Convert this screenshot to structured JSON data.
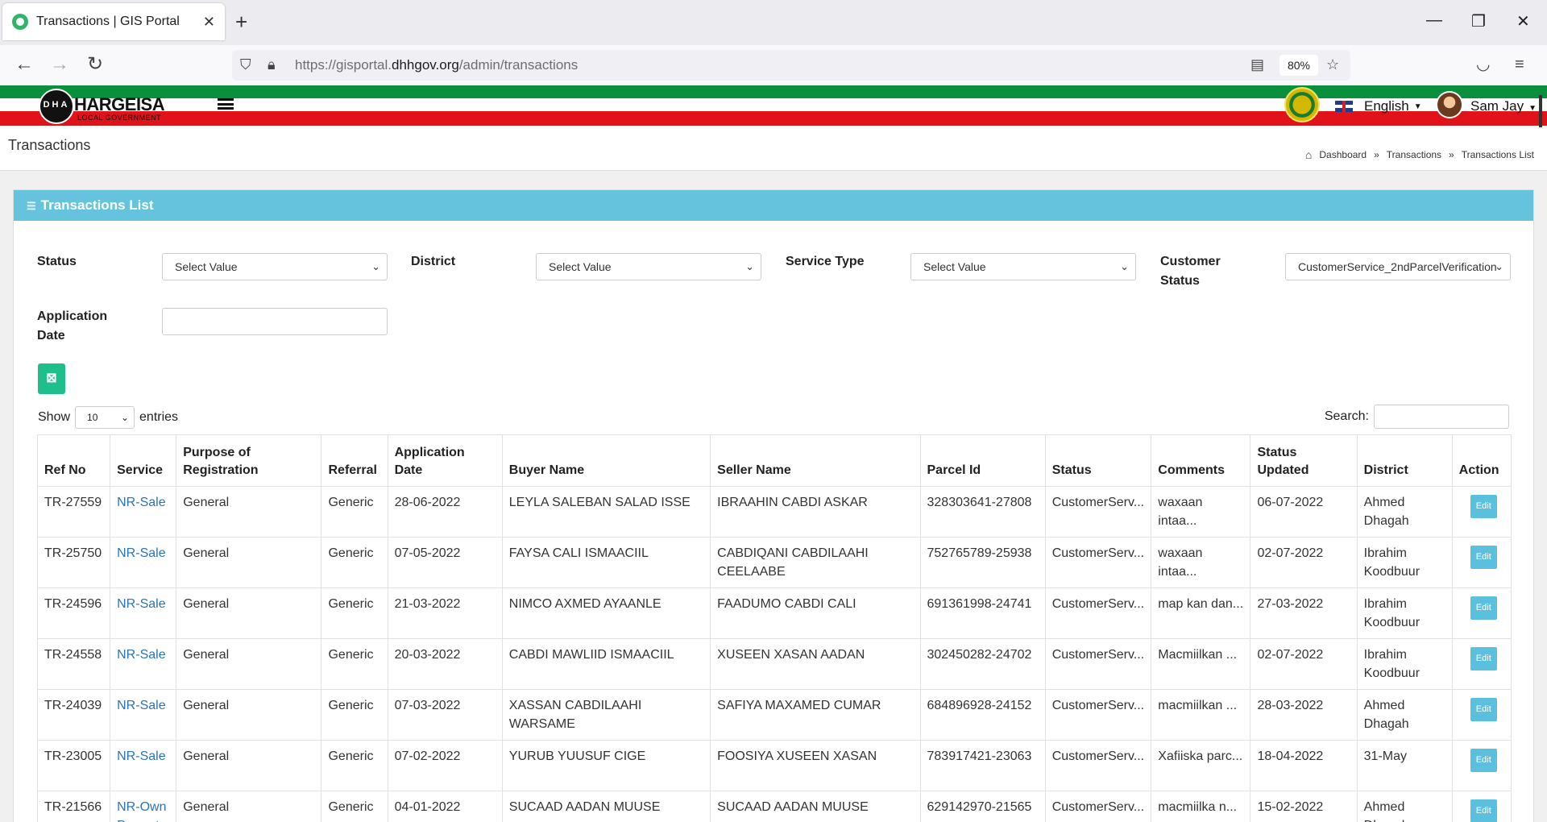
{
  "browser": {
    "tab_title": "Transactions | GIS Portal",
    "url_prefix": "https://gisportal.",
    "url_domain": "dhhgov.org",
    "url_path": "/admin/transactions",
    "zoom": "80%"
  },
  "header": {
    "logo_title": "HARGEISA",
    "logo_subtitle": "LOCAL GOVERNMENT",
    "logo_initials": "DHA",
    "language": "English",
    "user_name": "Sam Jay"
  },
  "page": {
    "title": "Transactions",
    "breadcrumb": [
      "Dashboard",
      "Transactions",
      "Transactions List"
    ],
    "breadcrumb_sep": "»"
  },
  "card": {
    "title": "Transactions List"
  },
  "filters": {
    "status_label": "Status",
    "status_value": "Select Value",
    "district_label": "District",
    "district_value": "Select Value",
    "service_type_label": "Service Type",
    "service_type_value": "Select Value",
    "customer_status_label_1": "Customer",
    "customer_status_label_2": "Status",
    "customer_status_value": "CustomerService_2ndParcelVerification",
    "application_date_label_1": "Application",
    "application_date_label_2": "Date"
  },
  "table_controls": {
    "show": "Show",
    "page_length": "10",
    "entries": "entries",
    "search": "Search:"
  },
  "table": {
    "columns": [
      "Ref No",
      "Service",
      "Purpose of Registration",
      "Referral",
      "Application Date",
      "Buyer Name",
      "Seller Name",
      "Parcel Id",
      "Status",
      "Comments",
      "Status Updated",
      "District",
      "Action"
    ],
    "edit_label": "Edit",
    "rows": [
      {
        "ref": "TR-27559",
        "service": "NR-Sale",
        "purpose": "General",
        "referral": "Generic",
        "app_date": "28-06-2022",
        "buyer": "LEYLA SALEBAN SALAD ISSE",
        "seller": "IBRAAHIN CABDI ASKAR",
        "parcel": "328303641-27808",
        "status": "CustomerServ...",
        "comments": "waxaan intaa...",
        "updated": "06-07-2022",
        "district": "Ahmed Dhagah"
      },
      {
        "ref": "TR-25750",
        "service": "NR-Sale",
        "purpose": "General",
        "referral": "Generic",
        "app_date": "07-05-2022",
        "buyer": "FAYSA CALI ISMAACIIL",
        "seller": "CABDIQANI CABDILAAHI CEELAABE",
        "parcel": "752765789-25938",
        "status": "CustomerServ...",
        "comments": "waxaan intaa...",
        "updated": "02-07-2022",
        "district": "Ibrahim Koodbuur"
      },
      {
        "ref": "TR-24596",
        "service": "NR-Sale",
        "purpose": "General",
        "referral": "Generic",
        "app_date": "21-03-2022",
        "buyer": "NIMCO AXMED AYAANLE",
        "seller": "FAADUMO CABDI CALI",
        "parcel": "691361998-24741",
        "status": "CustomerServ...",
        "comments": "map kan dan...",
        "updated": "27-03-2022",
        "district": "Ibrahim Koodbuur"
      },
      {
        "ref": "TR-24558",
        "service": "NR-Sale",
        "purpose": "General",
        "referral": "Generic",
        "app_date": "20-03-2022",
        "buyer": "CABDI MAWLIID ISMAACIIL",
        "seller": "XUSEEN XASAN AADAN",
        "parcel": "302450282-24702",
        "status": "CustomerServ...",
        "comments": "Macmiilkan ...",
        "updated": "02-07-2022",
        "district": "Ibrahim Koodbuur"
      },
      {
        "ref": "TR-24039",
        "service": "NR-Sale",
        "purpose": "General",
        "referral": "Generic",
        "app_date": "07-03-2022",
        "buyer": "XASSAN CABDILAAHI WARSAME",
        "seller": "SAFIYA MAXAMED CUMAR",
        "parcel": "684896928-24152",
        "status": "CustomerServ...",
        "comments": "macmiilkan ...",
        "updated": "28-03-2022",
        "district": "Ahmed Dhagah"
      },
      {
        "ref": "TR-23005",
        "service": "NR-Sale",
        "purpose": "General",
        "referral": "Generic",
        "app_date": "07-02-2022",
        "buyer": "YURUB YUUSUF CIGE",
        "seller": "FOOSIYA XUSEEN XASAN",
        "parcel": "783917421-23063",
        "status": "CustomerServ...",
        "comments": "Xafiiska parc...",
        "updated": "18-04-2022",
        "district": "31-May"
      },
      {
        "ref": "TR-21566",
        "service": "NR-Own Property",
        "purpose": "General",
        "referral": "Generic",
        "app_date": "04-01-2022",
        "buyer": "SUCAAD AADAN MUUSE",
        "seller": "SUCAAD AADAN MUUSE",
        "parcel": "629142970-21565",
        "status": "CustomerServ...",
        "comments": "macmiilka n...",
        "updated": "15-02-2022",
        "district": "Ahmed Dhagah"
      }
    ]
  }
}
